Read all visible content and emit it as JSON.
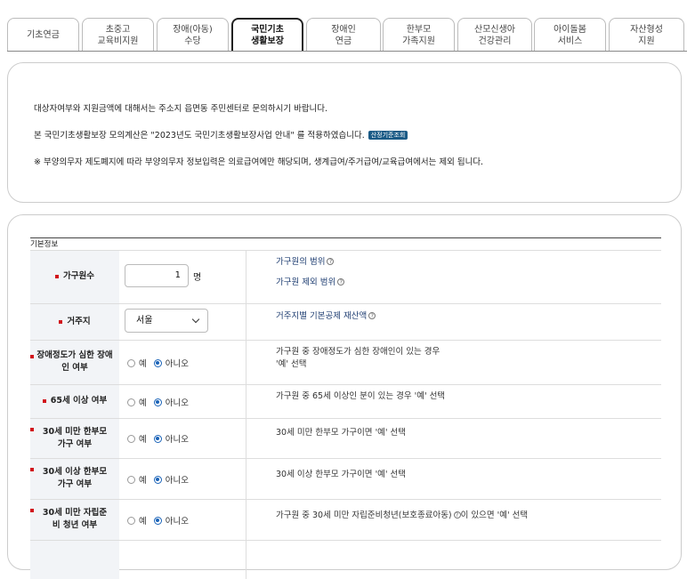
{
  "tabs": [
    {
      "label": "기초연금"
    },
    {
      "label": "초중고\n교육비지원"
    },
    {
      "label": "장애(아동)\n수당"
    },
    {
      "label": "국민기초\n생활보장"
    },
    {
      "label": "장애인\n연금"
    },
    {
      "label": "한부모\n가족지원"
    },
    {
      "label": "산모신생아\n건강관리"
    },
    {
      "label": "아이돌봄\n서비스"
    },
    {
      "label": "자산형성\n지원"
    }
  ],
  "active_tab": "국민기초\n생활보장",
  "notice": {
    "line1": "대상자여부와 지원금액에 대해서는 주소지 읍면동 주민센터로 문의하시기 바랍니다.",
    "line2": "본 국민기초생활보장 모의계산은 \"2023년도 국민기초생활보장사업 안내\" 를 적용하였습니다.",
    "badge": "산정기준조회",
    "line3": "※ 부양의무자 제도폐지에 따라 부양의무자 정보입력은 의료급여에만 해당되며, 생계급여/주거급여/교육급여에서는 제외 됩니다."
  },
  "section_title": "기본정보",
  "form": {
    "household": {
      "label": "가구원수",
      "value": "1",
      "unit": "명",
      "help1": "가구원의 범위",
      "help2": "가구원 제외 범위"
    },
    "residence": {
      "label": "거주지",
      "value": "서울",
      "help": "거주지별 기본공제 재산액"
    },
    "severe_disability": {
      "label": "장애정도가 심한 장애인 여부",
      "yes": "예",
      "no": "아니오",
      "desc1": "가구원 중 장애정도가 심한 장애인이 있는 경우",
      "desc2": "'예' 선택"
    },
    "over65": {
      "label": "65세 이상 여부",
      "yes": "예",
      "no": "아니오",
      "desc": "가구원 중 65세 이상인 분이 있는 경우 '예' 선택"
    },
    "single_parent_under30": {
      "label": "30세 미만 한부모 가구 여부",
      "yes": "예",
      "no": "아니오",
      "desc": "30세 미만 한부모 가구이면 '예' 선택"
    },
    "single_parent_over30": {
      "label": "30세 이상 한부모 가구 여부",
      "yes": "예",
      "no": "아니오",
      "desc": "30세 이상 한부모 가구이면 '예' 선택"
    },
    "youth_independence": {
      "label": "30세 미만 자립준비 청년 여부",
      "yes": "예",
      "no": "아니오",
      "desc": "가구원 중 30세 미만 자립준비청년(보호종료아동)",
      "desc_tail": "이 있으면 '예' 선택"
    }
  },
  "icons": {
    "help": "question-circle-icon",
    "dropdown": "chevron-down-icon",
    "required": "required-marker-icon"
  },
  "colors": {
    "required": "#d1121b",
    "radio_selected": "#1a63b8",
    "badge": "#1a5a86",
    "link": "#1f3e72"
  }
}
